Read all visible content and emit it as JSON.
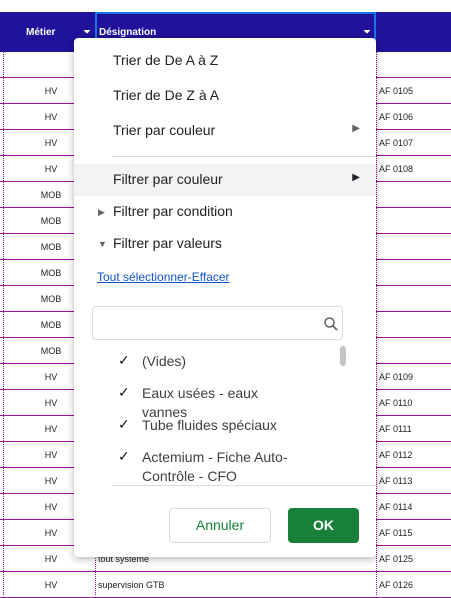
{
  "sheet": {
    "headers": {
      "metier": "Métier",
      "designation": "Désignation"
    },
    "rows": [
      {
        "metier": "",
        "designation": "",
        "code": ""
      },
      {
        "metier": "HV",
        "designation": "",
        "code": "AF 0105"
      },
      {
        "metier": "HV",
        "designation": "",
        "code": "AF 0106"
      },
      {
        "metier": "HV",
        "designation": "",
        "code": "AF 0107"
      },
      {
        "metier": "HV",
        "designation": "",
        "code": "AF 0108"
      },
      {
        "metier": "MOB",
        "designation": "",
        "code": ""
      },
      {
        "metier": "MOB",
        "designation": "",
        "code": ""
      },
      {
        "metier": "MOB",
        "designation": "",
        "code": ""
      },
      {
        "metier": "MOB",
        "designation": "",
        "code": ""
      },
      {
        "metier": "MOB",
        "designation": "",
        "code": ""
      },
      {
        "metier": "MOB",
        "designation": "",
        "code": ""
      },
      {
        "metier": "MOB",
        "designation": "",
        "code": ""
      },
      {
        "metier": "HV",
        "designation": "",
        "code": "AF 0109"
      },
      {
        "metier": "HV",
        "designation": "",
        "code": "AF 0110"
      },
      {
        "metier": "HV",
        "designation": "",
        "code": "AF 0111"
      },
      {
        "metier": "HV",
        "designation": "",
        "code": "AF 0112"
      },
      {
        "metier": "HV",
        "designation": "",
        "code": "AF 0113"
      },
      {
        "metier": "HV",
        "designation": "",
        "code": "AF 0114"
      },
      {
        "metier": "HV",
        "designation": "",
        "code": "AF 0115"
      },
      {
        "metier": "HV",
        "designation": "tout système",
        "code": "AF 0125"
      },
      {
        "metier": "HV",
        "designation": "supervision GTB",
        "code": "AF 0126"
      }
    ]
  },
  "menu": {
    "sort_az": "Trier de De A à Z",
    "sort_za": "Trier de De Z à A",
    "sort_color": "Trier par couleur",
    "filter_color": "Filtrer par couleur",
    "filter_condition": "Filtrer par condition",
    "filter_values": "Filtrer par valeurs",
    "select_all": "Tout sélectionner",
    "separator": "-",
    "clear": "Effacer",
    "search_value": "",
    "values": [
      {
        "label": "(Vides)",
        "checked": true
      },
      {
        "label": "Eaux usées - eaux vannes",
        "checked": true
      },
      {
        "label": "Tube fluides spéciaux",
        "checked": true
      },
      {
        "label": "Actemium - Fiche Auto-Contrôle - CFO",
        "checked": true
      }
    ],
    "cancel": "Annuler",
    "ok": "OK"
  },
  "colors": {
    "header_bg": "#20129a",
    "row_line": "#a0159f",
    "accent_green": "#188038",
    "link": "#1155cc"
  },
  "icons": [
    "filter-icon",
    "search-icon",
    "check-icon",
    "chevron-right-icon",
    "triangle-right-icon",
    "triangle-down-icon"
  ]
}
